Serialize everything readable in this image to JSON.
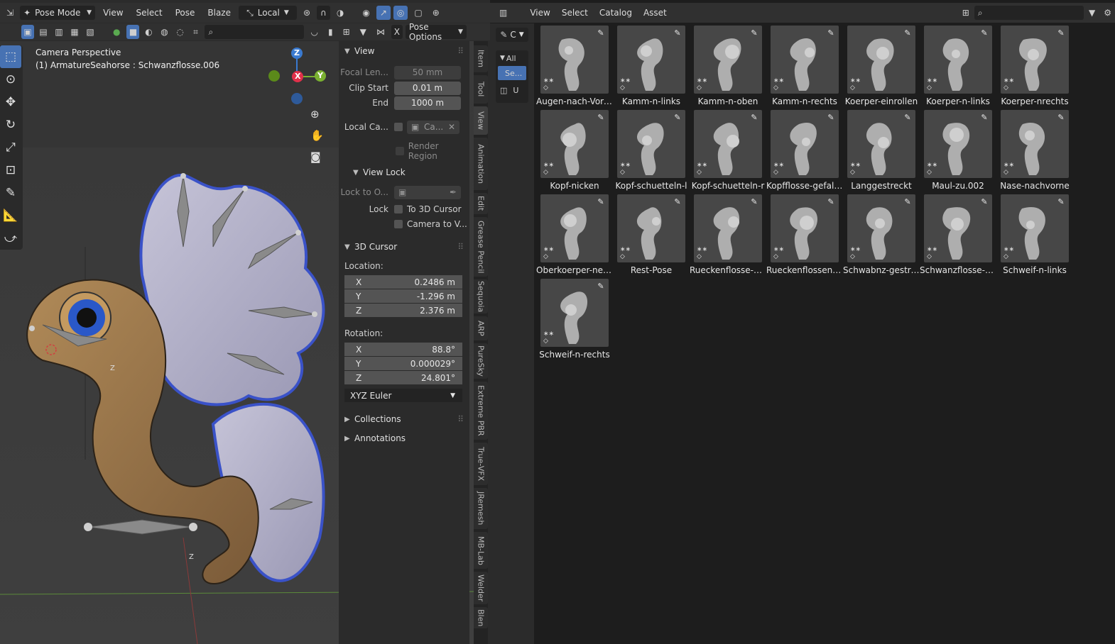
{
  "header": {
    "mode": "Pose Mode",
    "menus": [
      "View",
      "Select",
      "Pose",
      "Blaze"
    ],
    "transform_orientation": "Local",
    "pose_options": "Pose Options",
    "x_label": "X"
  },
  "viewport": {
    "camera_label": "Camera Perspective",
    "object_label": "(1) ArmatureSeahorse : Schwanzflosse.006",
    "gizmo": {
      "x": "X",
      "y": "Y",
      "z": "Z"
    },
    "bone_axis_labels": [
      "Z",
      "Z"
    ]
  },
  "npanel": {
    "view": {
      "title": "View",
      "focal_length_label": "Focal Len...",
      "focal_length": "50 mm",
      "clip_start_label": "Clip Start",
      "clip_start": "0.01 m",
      "end_label": "End",
      "end": "1000 m",
      "local_camera_label": "Local Ca...",
      "local_camera_value": "Ca...",
      "render_region": "Render Region"
    },
    "view_lock": {
      "title": "View Lock",
      "lock_to_label": "Lock to O...",
      "lock_label": "Lock",
      "to_3d_cursor": "To 3D Cursor",
      "camera_to_view": "Camera to V..."
    },
    "cursor": {
      "title": "3D Cursor",
      "location_label": "Location:",
      "location": [
        {
          "axis": "X",
          "value": "0.2486 m"
        },
        {
          "axis": "Y",
          "value": "-1.296 m"
        },
        {
          "axis": "Z",
          "value": "2.376 m"
        }
      ],
      "rotation_label": "Rotation:",
      "rotation": [
        {
          "axis": "X",
          "value": "88.8°"
        },
        {
          "axis": "Y",
          "value": "0.000029°"
        },
        {
          "axis": "Z",
          "value": "24.801°"
        }
      ],
      "rotation_mode": "XYZ Euler"
    },
    "collections": "Collections",
    "annotations": "Annotations"
  },
  "side_tabs": [
    "Item",
    "Tool",
    "View",
    "Animation",
    "Edit",
    "Grease Pencil",
    "Sequoia",
    "ARP",
    "PureSky",
    "Extreme PBR",
    "True-VFX",
    "JRemesh",
    "MB-Lab",
    "Welder",
    "Blen"
  ],
  "asset_browser": {
    "menus": [
      "View",
      "Select",
      "Catalog",
      "Asset"
    ],
    "library_short": "C",
    "side_items": [
      "All",
      "Se...",
      "U"
    ],
    "assets": [
      "Augen-nach-Vorne",
      "Kamm-n-links",
      "Kamm-n-oben",
      "Kamm-n-rechts",
      "Koerper-einrollen",
      "Koerper-n-links",
      "Koerper-nrechts",
      "Kopf-nicken",
      "Kopf-schuetteln-l",
      "Kopf-schuetteln-r",
      "Kopfflosse-gefaltet",
      "Langgestreckt",
      "Maul-zu.002",
      "Nase-nachvorne",
      "Oberkoerper-neigen",
      "Rest-Pose",
      "Rueckenflosse-an...",
      "Rueckenflossen-g...",
      "Schwabnz-gestrec...",
      "Schwanzflosse-gef...",
      "Schweif-n-links",
      "Schweif-n-rechts"
    ]
  }
}
